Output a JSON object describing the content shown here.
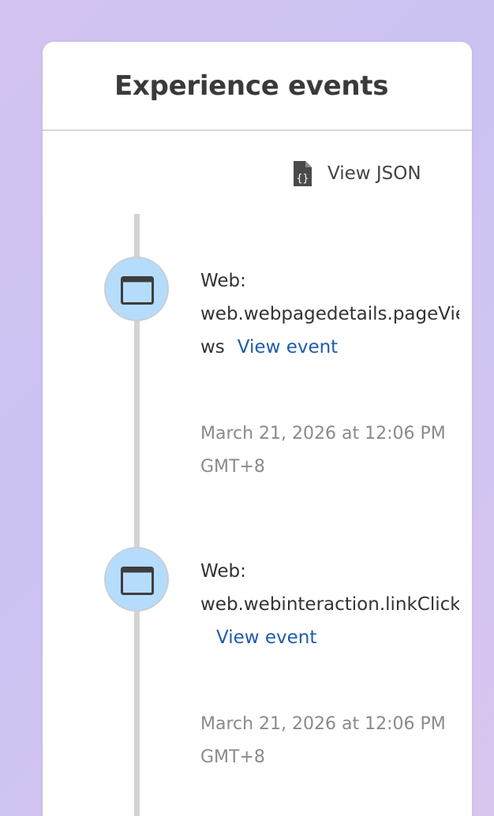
{
  "panel": {
    "title": "Experience events"
  },
  "toolbar": {
    "view_json_label": "View JSON"
  },
  "events": [
    {
      "prefix": "Web:",
      "name_part1": "web.webpagedetails.pageVie",
      "name_part2": "ws",
      "link_label": "View event",
      "timestamp_line1": "March 21, 2026 at 12:06 PM",
      "timestamp_line2": "GMT+8",
      "icon": "browser-window-icon"
    },
    {
      "prefix": "Web:",
      "name_part1": "web.webinteraction.linkClicks",
      "link_label": "View event",
      "timestamp_line1": "March 21, 2026 at 12:06 PM",
      "timestamp_line2": "GMT+8",
      "icon": "browser-window-icon"
    }
  ],
  "colors": {
    "node_fill": "#b6dcfc",
    "link": "#1e5ca8",
    "timeline": "#d4d4d4"
  }
}
